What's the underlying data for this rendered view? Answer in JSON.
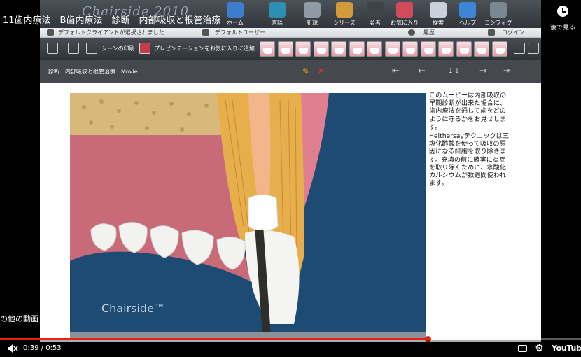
{
  "video": {
    "title": "11歯内療法　B歯内療法　診断　内部吸収と根管治療",
    "watch_later_label": "後で見る",
    "more_videos_label": "の他の動画",
    "time_current": "0:39",
    "time_separator": " / ",
    "time_total": "0:53",
    "progress_fraction": 0.736,
    "platform_label": "YouTube"
  },
  "app": {
    "brand": "Chairside 2010",
    "nav": [
      {
        "label": "ホーム",
        "icon": "home-icon",
        "color": "#3c7dd0"
      },
      {
        "label": "言語",
        "icon": "language-icon",
        "color": "#2f8fb3"
      },
      {
        "label": "新規",
        "icon": "new-icon",
        "color": "#8e9aa6"
      },
      {
        "label": "シリーズ",
        "icon": "series-icon",
        "color": "#d29a3a"
      },
      {
        "label": "著者",
        "icon": "author-icon",
        "color": "#3d4349"
      },
      {
        "label": "お気に入り",
        "icon": "favorites-icon",
        "color": "#d14b5d"
      },
      {
        "label": "検索",
        "icon": "search-icon",
        "color": "#c9d2da"
      },
      {
        "label": "ヘルプ",
        "icon": "help-icon",
        "color": "#3d86d6"
      },
      {
        "label": "コンフィグ",
        "icon": "config-icon",
        "color": "#7b8791"
      }
    ],
    "status": {
      "client": "デフォルトクライアントが選択されました",
      "user": "デフォルトユーザー",
      "history": "履歴",
      "login": "ログイン"
    },
    "toolbar": {
      "scene_print": "シーンの印刷",
      "add_favorite": "プレゼンテーションをお気に入りに追加"
    },
    "breadcrumb": "診断　内部吸収と根管治療　Movie",
    "page_indicator": "1-1",
    "logo_text": "Chairside™",
    "description": [
      "このムービーは内部吸収の早期診断が出来た場合に、歯内療法を通して歯をどのように守るかをお見せします。",
      "Heithersayテクニックは三塩化酢酸を使って吸収の原因になる細胞を取り除きます。充填の前に確実に炎症を取り除くために、水酸化カルシウムが数週間使われます。"
    ]
  }
}
